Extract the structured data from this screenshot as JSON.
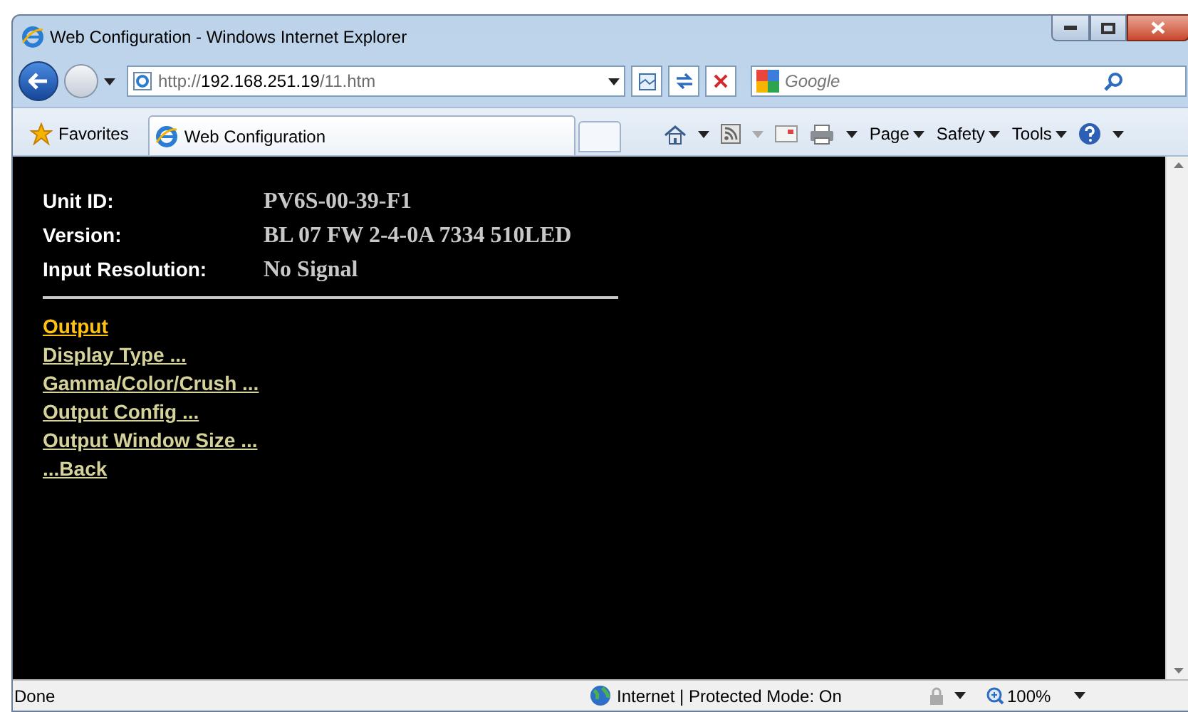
{
  "window": {
    "title": "Web Configuration - Windows Internet Explorer"
  },
  "address_bar": {
    "url_prefix": "http://",
    "url_host": "192.168.251.19",
    "url_path": "/11.htm"
  },
  "search": {
    "placeholder": "Google"
  },
  "favorites": {
    "label": "Favorites"
  },
  "tab": {
    "label": "Web Configuration"
  },
  "command_bar": [
    "Page",
    "Safety",
    "Tools"
  ],
  "info": [
    {
      "label": "Unit ID:",
      "value": "PV6S-00-39-F1"
    },
    {
      "label": "Version:",
      "value": "BL 07 FW 2-4-0A 7334 510LED"
    },
    {
      "label": "Input Resolution:",
      "value": "No Signal"
    }
  ],
  "menu": [
    {
      "label": "Output",
      "selected": true
    },
    {
      "label": "Display Type ...",
      "selected": false
    },
    {
      "label": "Gamma/Color/Crush ...",
      "selected": false
    },
    {
      "label": "Output Config ...",
      "selected": false
    },
    {
      "label": "Output Window Size ...",
      "selected": false
    },
    {
      "label": "...Back",
      "selected": false
    }
  ],
  "status_bar": {
    "status": "Done",
    "zone": "Internet | Protected Mode: On",
    "zoom": "100%"
  }
}
